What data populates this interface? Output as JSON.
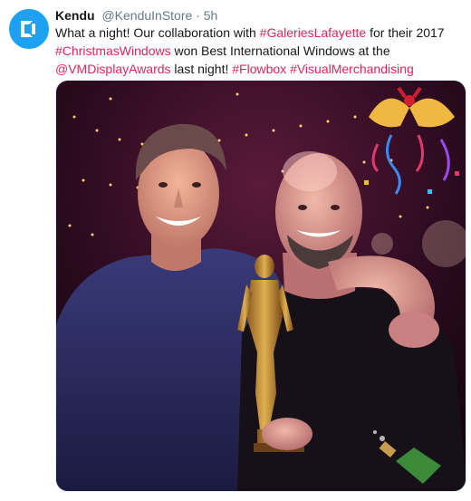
{
  "tweet": {
    "author_name": "Kendu",
    "author_handle": "@KenduInStore",
    "separator": "·",
    "time": "5h",
    "text": {
      "t1": "What a night! Our collaboration with ",
      "tag1": "#GaleriesLafayette",
      "t2": " for their 2017 ",
      "tag2": "#ChristmasWindows",
      "t3": " won Best International Windows at the ",
      "tag3": "@VMDisplayAwards",
      "t4": " last night! ",
      "tag4": "#Flowbox",
      "t5": " ",
      "tag5": "#VisualMerchandising"
    }
  },
  "colors": {
    "avatar_bg": "#1da1f2",
    "link": "#e0245e",
    "text": "#14171a",
    "muted": "#657786"
  },
  "icons": {
    "avatar": "kendu-logo",
    "decorations": [
      "party-bells-icon",
      "confetti-icon",
      "champagne-bottle-icon"
    ]
  }
}
